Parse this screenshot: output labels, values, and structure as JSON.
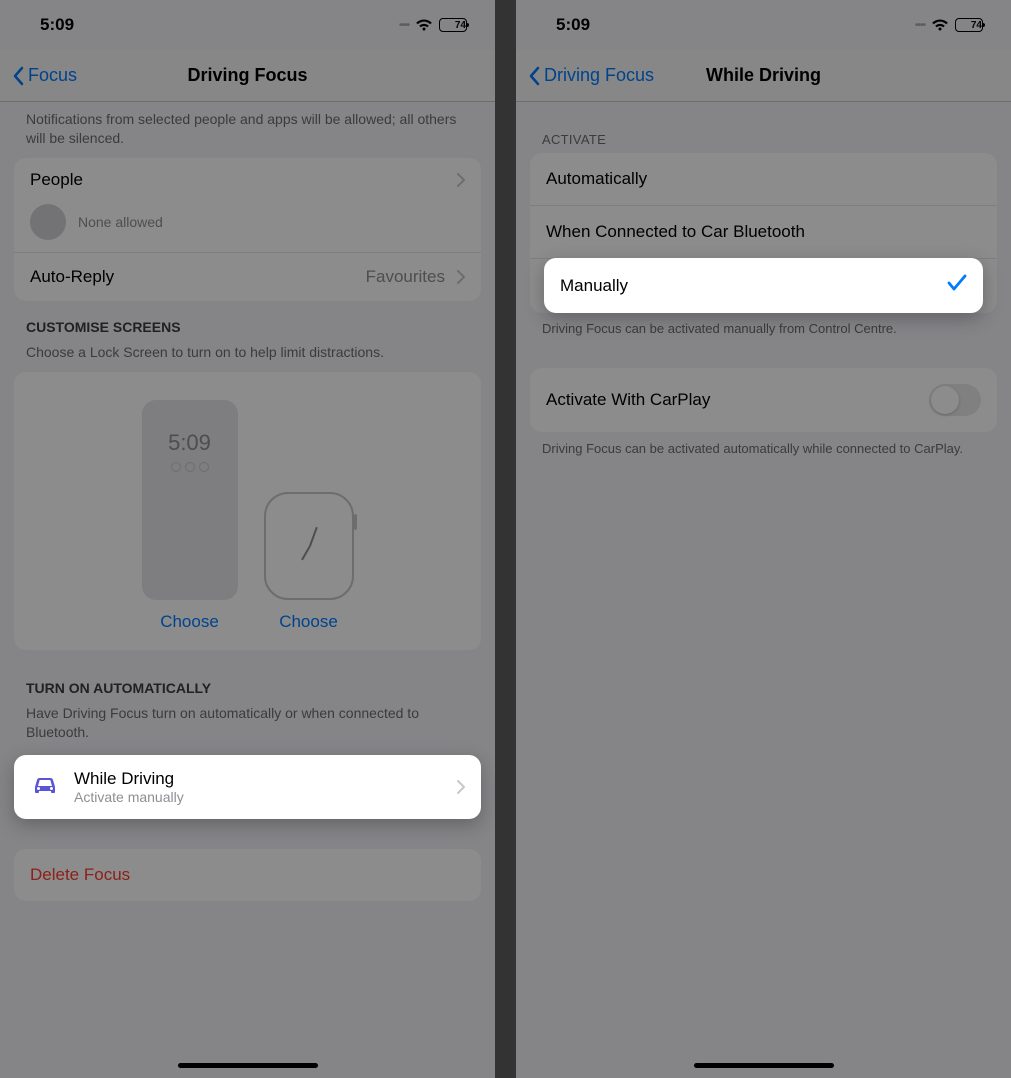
{
  "status": {
    "time": "5:09",
    "battery": "74"
  },
  "left": {
    "nav": {
      "back": "Focus",
      "title": "Driving Focus"
    },
    "intro": "Notifications from selected people and apps will be allowed; all others will be silenced.",
    "people": {
      "label": "People",
      "none": "None allowed"
    },
    "autoreply": {
      "label": "Auto-Reply",
      "value": "Favourites"
    },
    "screens": {
      "header": "CUSTOMISE SCREENS",
      "desc": "Choose a Lock Screen to turn on to help limit distractions.",
      "lock_time": "5:09",
      "choose": "Choose"
    },
    "auto": {
      "header": "TURN ON AUTOMATICALLY",
      "desc": "Have Driving Focus turn on automatically or when connected to Bluetooth."
    },
    "while": {
      "title": "While Driving",
      "sub": "Activate manually"
    },
    "delete": "Delete Focus"
  },
  "right": {
    "nav": {
      "back": "Driving Focus",
      "title": "While Driving"
    },
    "activate_header": "ACTIVATE",
    "opts": {
      "auto": "Automatically",
      "bt": "When Connected to Car Bluetooth",
      "manual": "Manually"
    },
    "activate_footer": "Driving Focus can be activated manually from Control Centre.",
    "carplay": {
      "label": "Activate With CarPlay"
    },
    "carplay_footer": "Driving Focus can be activated automatically while connected to CarPlay."
  }
}
